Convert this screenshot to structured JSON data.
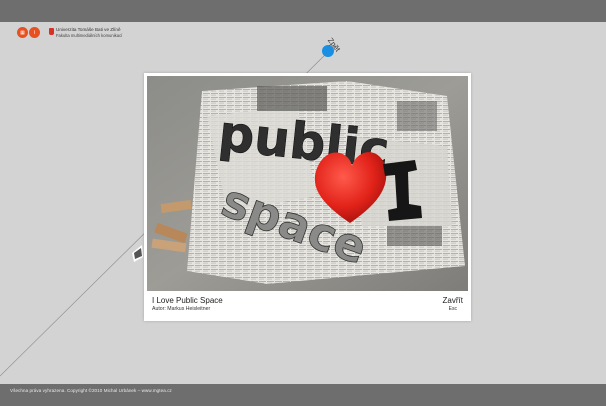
{
  "header": {
    "menu_icon": "grid-icon",
    "info_label": "i",
    "university": "Univerzita Tomáše Bati ve Zlíně",
    "faculty": "Fakulta multimediálních komunikací"
  },
  "navigation": {
    "back_label": "Zpět"
  },
  "lightbox": {
    "photo_title": "I Love Public Space",
    "author_line": "Autor: Markus Heisleitner",
    "close_label": "Zavřít",
    "close_shortcut": "Esc"
  },
  "photo_scene": {
    "words": [
      "public",
      "space",
      "I"
    ],
    "heart_color": "#e2231a"
  },
  "footer": {
    "copyright": "Všechna práva vyhrazena. Copyright ©2010 Michal Urbánek – www.mgtea.cz"
  },
  "colors": {
    "accent_orange": "#e8501f",
    "accent_blue": "#1a8ee2",
    "bar_gray": "#6e6e6e",
    "background": "#d3d3d3"
  }
}
